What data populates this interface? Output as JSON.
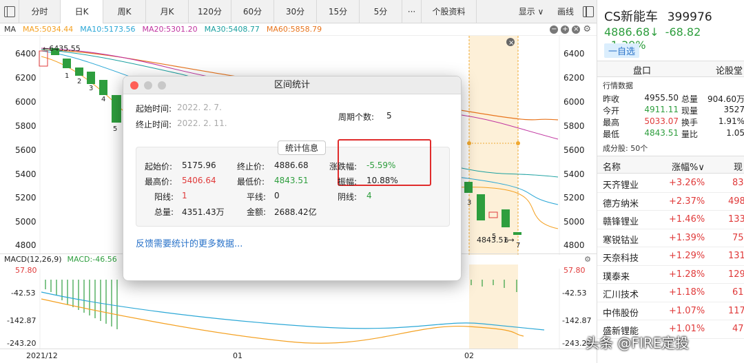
{
  "toolbar": {
    "tabs": [
      "分时",
      "日K",
      "周K",
      "月K",
      "120分",
      "60分",
      "30分",
      "15分",
      "5分"
    ],
    "more": "···",
    "profile": "个股资料",
    "display": "显示 ∨",
    "draw": "画线"
  },
  "ma": {
    "label": "MA",
    "ma5": "MA5:5034.44",
    "ma10": "MA10:5173.56",
    "ma20": "MA20:5301.20",
    "ma30": "MA30:5408.77",
    "ma60": "MA60:5858.79",
    "colors": {
      "ma5": "#f4a020",
      "ma10": "#2aa7d6",
      "ma20": "#c034a0",
      "ma30": "#1aa0a0",
      "ma60": "#e8741c"
    }
  },
  "chart": {
    "y_ticks": [
      "6400",
      "6200",
      "6000",
      "5800",
      "5600",
      "5400",
      "5200",
      "5000",
      "4800"
    ],
    "high_label": "6435.55",
    "low_label": "4843.51",
    "candle_numbers": [
      "1",
      "2",
      "3",
      "4",
      "5"
    ],
    "right_numbers": [
      "3",
      "5",
      "6",
      "7"
    ]
  },
  "macd": {
    "label": "MACD(12,26,9)",
    "value": "MACD:-46.56",
    "y_ticks": [
      "57.80",
      "-42.53",
      "-142.87",
      "-243.20"
    ]
  },
  "dates": [
    "2021/12",
    "01",
    "02"
  ],
  "dialog": {
    "title": "区间统计",
    "start_label": "起始时间:",
    "start_value": "2022.  2.  7.",
    "end_label": "终止时间:",
    "end_value": "2022.  2. 11.",
    "period_label": "周期个数:",
    "period_value": "5",
    "stat_button": "统计信息",
    "start_price_label": "起始价:",
    "start_price": "5175.96",
    "end_price_label": "终止价:",
    "end_price": "4886.68",
    "change_label": "涨跌幅:",
    "change_value": "-5.59%",
    "high_label": "最高价:",
    "high_value": "5406.64",
    "low_label": "最低价:",
    "low_value": "4843.51",
    "amp_label": "振幅:",
    "amp_value": "10.88%",
    "yang_label": "阳线:",
    "yang_value": "1",
    "flat_label": "平线:",
    "flat_value": "0",
    "yin_label": "阴线:",
    "yin_value": "4",
    "vol_label": "总量:",
    "vol_value": "4351.43万",
    "amount_label": "金额:",
    "amount_value": "2688.42亿",
    "feedback": "反馈需要统计的更多数据..."
  },
  "stock": {
    "name": "CS新能车",
    "code": "399976",
    "price": "4886.68↓",
    "change": "-68.82",
    "pct": "-1.39%",
    "fav": "一自选"
  },
  "right_tabs": [
    "盘口",
    "论股堂"
  ],
  "quote": {
    "section": "行情数据",
    "rows": [
      [
        "昨收",
        "4955.50",
        "总量",
        "904.60万"
      ],
      [
        "今开",
        "4911.11",
        "现量",
        "3527"
      ],
      [
        "最高",
        "5033.07",
        "换手",
        "1.91%"
      ],
      [
        "最低",
        "4843.51",
        "量比",
        "1.05"
      ]
    ]
  },
  "constituents": {
    "title": "成分股: 50个",
    "headers": [
      "名称",
      "涨幅%∨",
      "现"
    ],
    "rows": [
      [
        "天齐锂业",
        "+3.26%",
        "83"
      ],
      [
        "德方纳米",
        "+2.37%",
        "498"
      ],
      [
        "赣锋锂业",
        "+1.46%",
        "133"
      ],
      [
        "寒锐钴业",
        "+1.39%",
        "75"
      ],
      [
        "天奈科技",
        "+1.29%",
        "131"
      ],
      [
        "璞泰来",
        "+1.28%",
        "129"
      ],
      [
        "汇川技术",
        "+1.18%",
        "61"
      ],
      [
        "中伟股份",
        "+1.07%",
        "117"
      ],
      [
        "盛新锂能",
        "+1.01%",
        "47"
      ]
    ]
  },
  "watermark": "头条 @FIRE定投"
}
